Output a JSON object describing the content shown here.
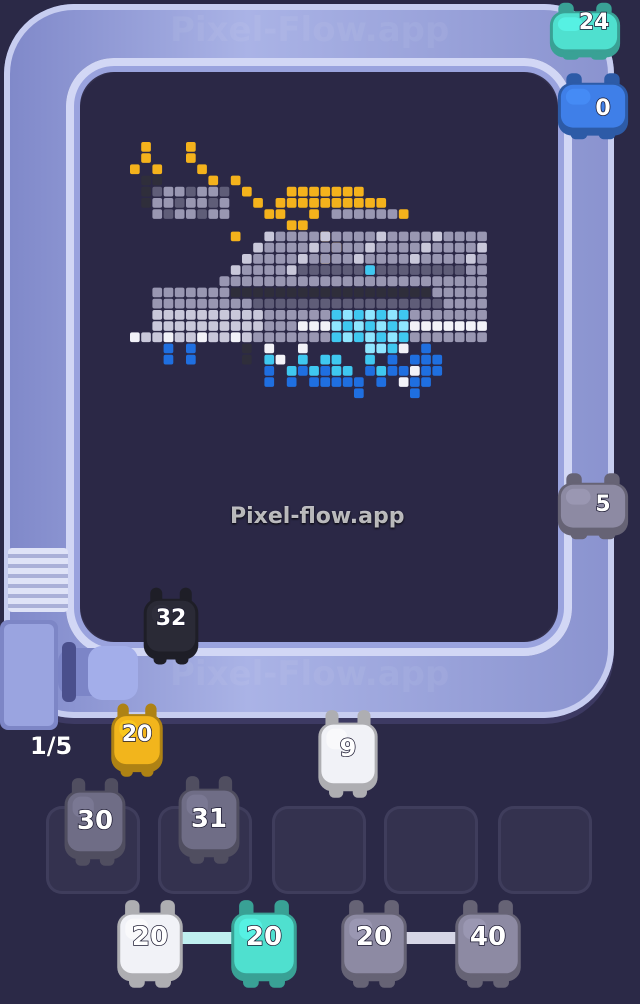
{
  "watermark": "Pixel-flow.app",
  "watermark_track_top": "Pixel-Flow.app",
  "watermark_track_bottom": "Pixel-Flow.app",
  "level_counter": "1/5",
  "track_shooters": [
    {
      "count": "24",
      "color": "#4fe0cf"
    },
    {
      "count": "0",
      "color": "#3f7fe8"
    },
    {
      "count": "5",
      "color": "#8d8aa3"
    }
  ],
  "queue_front": {
    "count": "32",
    "color": "#2a2a36"
  },
  "active_pig": {
    "count": "20",
    "color": "#f2b51c"
  },
  "waiting_pig": {
    "count": "9",
    "color": "#f1f2f7"
  },
  "holding_slots": [
    {
      "count": "30",
      "color": "#6f6d86"
    },
    {
      "count": "31",
      "color": "#6f6d86"
    },
    {
      "count": "",
      "color": ""
    },
    {
      "count": "",
      "color": ""
    },
    {
      "count": "",
      "color": ""
    }
  ],
  "linked_pigs": [
    {
      "count": "20",
      "color": "#f1f2f7"
    },
    {
      "count": "20",
      "color": "#4fe0cf"
    },
    {
      "count": "20",
      "color": "#8d8aa3"
    },
    {
      "count": "40",
      "color": "#8d8aa3"
    }
  ],
  "palette": {
    "yellow": "#f4b21c",
    "black": "#2f2e3b",
    "dark_gray": "#5f5d78",
    "gray": "#9997b2",
    "light_gray": "#c9c8da",
    "white": "#f2f2f8",
    "cyan": "#3fc8f0",
    "light_cyan": "#8fe6ff",
    "blue": "#1f6fe0"
  }
}
